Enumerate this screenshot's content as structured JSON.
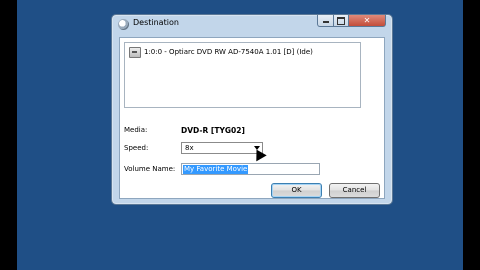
{
  "window": {
    "title": "Destination",
    "close_glyph": "✕"
  },
  "drive_list": {
    "items": [
      {
        "label": "1:0:0 - Optiarc DVD RW AD-7540A 1.01 [D] (Ide)",
        "icon": "optical-drive-icon"
      }
    ]
  },
  "form": {
    "media_label": "Media:",
    "media_value": "DVD-R [TYG02]",
    "speed_label": "Speed:",
    "speed_value": "8x",
    "volume_label": "Volume Name:",
    "volume_value": "My Favorite Movie"
  },
  "buttons": {
    "ok": "OK",
    "cancel": "Cancel"
  },
  "colors": {
    "desktop": "#1f4f86",
    "selection": "#3399ff"
  }
}
